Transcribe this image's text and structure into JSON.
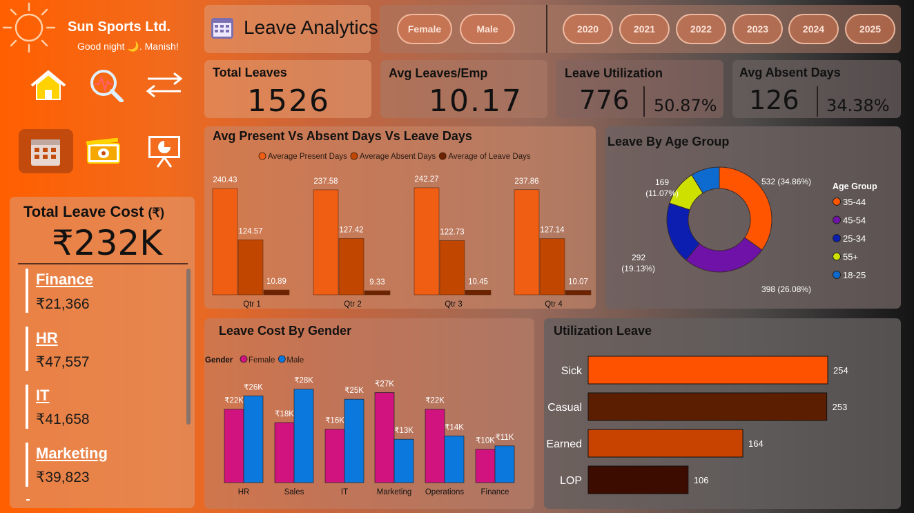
{
  "brand": {
    "name": "Sun Sports Ltd.",
    "greeting": "Good night 🌙. Manish!"
  },
  "page_title": "Leave Analytics",
  "nav": [
    "home-icon",
    "analytics-icon",
    "swap-icon",
    "calendar-icon",
    "money-icon",
    "presentation-icon"
  ],
  "filters": {
    "gender": [
      "Female",
      "Male"
    ],
    "years": [
      "2020",
      "2021",
      "2022",
      "2023",
      "2024",
      "2025"
    ]
  },
  "kpis": {
    "total_leaves": {
      "label": "Total Leaves",
      "value": "1526"
    },
    "avg_leaves": {
      "label": "Avg Leaves/Emp",
      "value": "10.17"
    },
    "utilization": {
      "label": "Leave Utilization",
      "value": "776",
      "pct": "50.87%"
    },
    "absent": {
      "label": "Avg Absent Days",
      "value": "126",
      "pct": "34.38%"
    }
  },
  "leave_cost": {
    "title": "Total Leave Cost",
    "unit": "(₹)",
    "total": "₹232K",
    "departments": [
      {
        "name": "Finance",
        "value": "₹21,366"
      },
      {
        "name": "HR",
        "value": "₹47,557"
      },
      {
        "name": "IT",
        "value": "₹41,658"
      },
      {
        "name": "Marketing",
        "value": "₹39,823"
      }
    ]
  },
  "colors": {
    "present": "#f05e14",
    "absent": "#c14600",
    "leave": "#6e2300",
    "female": "#d0137e",
    "male": "#0a78dc",
    "sick": "#ff5200",
    "casual": "#5c1e00",
    "earned": "#c84200",
    "lop": "#3c0c00"
  },
  "chart_data": [
    {
      "type": "bar",
      "title": "Avg Present Vs Absent Days Vs Leave Days",
      "categories": [
        "Qtr 1",
        "Qtr 2",
        "Qtr 3",
        "Qtr 4"
      ],
      "series": [
        {
          "name": "Average Present Days",
          "values": [
            240.43,
            237.58,
            242.27,
            237.86
          ]
        },
        {
          "name": "Average Absent Days",
          "values": [
            124.57,
            127.42,
            122.73,
            127.14
          ]
        },
        {
          "name": "Average of Leave Days",
          "values": [
            10.89,
            9.33,
            10.45,
            10.07
          ]
        }
      ],
      "ylim": [
        0,
        250
      ],
      "legend": "top"
    },
    {
      "type": "pie",
      "title": "Leave By Age Group",
      "legend_title": "Age Group",
      "slices": [
        {
          "label": "35-44",
          "value": 532,
          "text": "532 (34.86%)",
          "color": "#ff5500"
        },
        {
          "label": "45-54",
          "value": 398,
          "text": "398 (26.08%)",
          "color": "#6e12a8"
        },
        {
          "label": "25-34",
          "value": 292,
          "text": "292 (19.13%)",
          "color": "#0c1eb0"
        },
        {
          "label": "55+",
          "value": 169,
          "text": "169 (11.07%)",
          "color": "#cde000"
        },
        {
          "label": "18-25",
          "value": 135,
          "text": "",
          "color": "#0d6bd0"
        }
      ],
      "legend": "right"
    },
    {
      "type": "bar",
      "title": "Leave Cost By Gender",
      "legend_title": "Gender",
      "categories": [
        "HR",
        "Sales",
        "IT",
        "Marketing",
        "Operations",
        "Finance"
      ],
      "series": [
        {
          "name": "Female",
          "values": [
            22,
            18,
            16,
            27,
            22,
            10
          ],
          "labels": [
            "₹22K",
            "₹18K",
            "₹16K",
            "₹27K",
            "₹22K",
            "₹10K"
          ]
        },
        {
          "name": "Male",
          "values": [
            26,
            28,
            25,
            13,
            14,
            11
          ],
          "labels": [
            "₹26K",
            "₹28K",
            "₹25K",
            "₹13K",
            "₹14K",
            "₹11K"
          ]
        }
      ],
      "ylim": [
        0,
        30
      ],
      "legend": "top-left"
    },
    {
      "type": "bar",
      "orientation": "horizontal",
      "title": "Utilization Leave",
      "categories": [
        "Sick",
        "Casual",
        "Earned",
        "LOP"
      ],
      "values": [
        254,
        253,
        164,
        106
      ],
      "xlim": [
        0,
        254
      ]
    }
  ]
}
